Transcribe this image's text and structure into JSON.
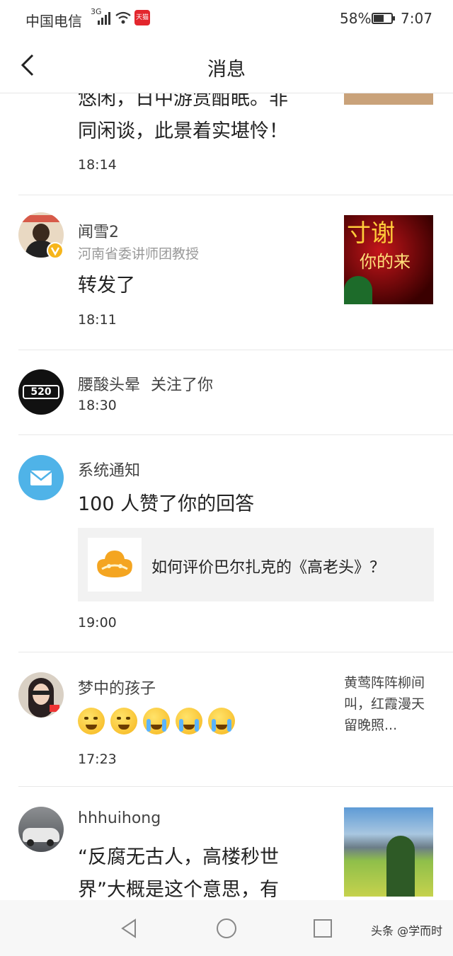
{
  "status": {
    "carrier": "中国电信",
    "network": "3G",
    "tmall": "天猫",
    "battery": "58%",
    "battery_level": 0.58,
    "time": "7:07"
  },
  "header": {
    "title": "消息"
  },
  "items": [
    {
      "message_lines": [
        "悠闲，日中游赏酣眠。非",
        "同闲谈，此景着实堪怜！"
      ],
      "time": "18:14"
    },
    {
      "name": "闻雪2",
      "subtitle": "河南省委讲师团教授",
      "message": "转发了",
      "time": "18:11",
      "thumb_lines": [
        "寸谢",
        "你的来"
      ]
    },
    {
      "name": "腰酸头晕",
      "action": "关注了你",
      "time": "18:30",
      "avatar_text": "520"
    },
    {
      "name": "系统通知",
      "message": "100 人赞了你的回答",
      "card_text": "如何评价巴尔扎克的《高老头》？",
      "time": "19:00"
    },
    {
      "name": "梦中的孩子",
      "time": "17:23",
      "side_lines": [
        "黄莺阵阵柳间",
        "叫，红霞漫天",
        "留晚照..."
      ]
    },
    {
      "name": "hhhuihong",
      "message_lines": [
        "“反腐无古人，高楼秒世",
        "界”大概是这个意思，有"
      ]
    }
  ],
  "bottom_bar": {
    "watermark": "头条 @学而时"
  },
  "colors": {
    "accent_blue": "#4fb3e8",
    "divider": "#e8e8e8",
    "verified": "#f6b51b"
  },
  "icons": [
    "back-icon",
    "mail-icon",
    "verified-icon",
    "nav-back-icon",
    "nav-home-icon",
    "nav-recent-icon"
  ]
}
